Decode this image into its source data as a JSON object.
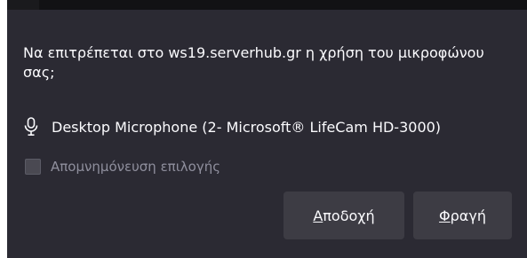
{
  "prompt": {
    "text": "Να επιτρέπεται στο ws19.serverhub.gr η χρήση του μικροφώνου σας;"
  },
  "device": {
    "icon": "microphone-icon",
    "label": "Desktop Microphone (2- Microsoft® LifeCam HD-3000)"
  },
  "remember": {
    "label": "Απομνημόνευση επιλογής",
    "checked": false
  },
  "buttons": {
    "accept": {
      "access_key": "Α",
      "rest": "ποδοχή"
    },
    "block": {
      "access_key": "Φ",
      "rest": "ραγή"
    }
  },
  "colors": {
    "panel_bg": "#2b2a33",
    "button_bg": "#3d3c44",
    "text": "#fbfbfe",
    "muted_text": "#8f8f9d"
  }
}
